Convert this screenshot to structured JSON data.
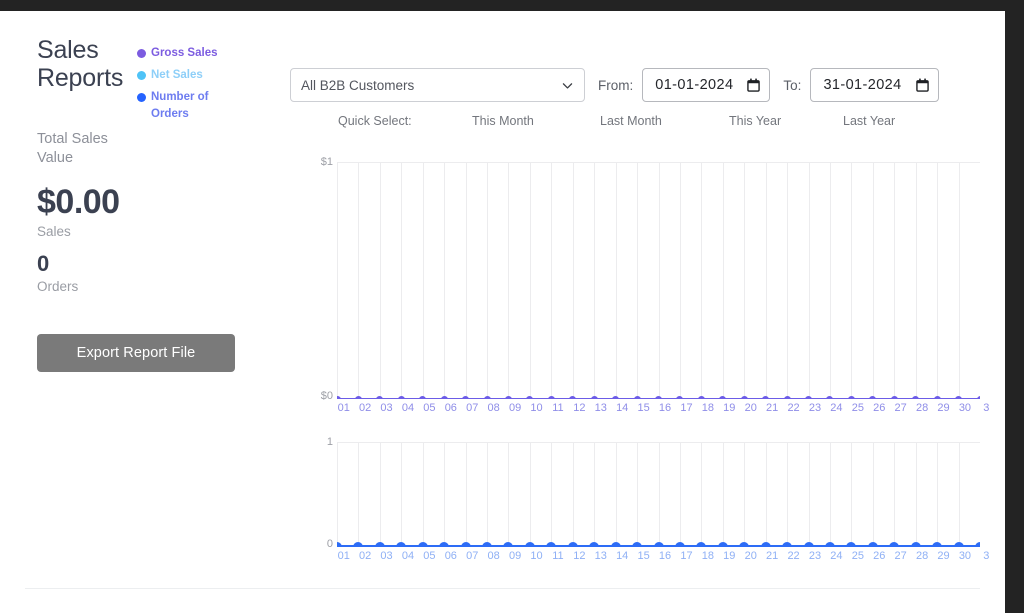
{
  "window": {
    "chrome_color": "#232323",
    "page_background": "#ffffff"
  },
  "summary": {
    "title": "Sales Reports",
    "subtitle": "Total Sales Value",
    "sales_value": "$0.00",
    "sales_caption": "Sales",
    "orders_value": "0",
    "orders_caption": "Orders",
    "export_button": "Export Report File",
    "export_button_color": "#7a7a7a"
  },
  "legend": [
    {
      "label": "Gross Sales",
      "color": "#7c5ce0"
    },
    {
      "label": "Net Sales",
      "color": "#4fc3f7"
    },
    {
      "label": "Number of Orders",
      "color": "#2563ff"
    }
  ],
  "controls": {
    "customer_select": {
      "value": "All B2B Customers",
      "icon": "chevron-down-icon"
    },
    "from": {
      "label": "From:",
      "value": "01-01-2024",
      "icon": "calendar-icon"
    },
    "to": {
      "label": "To:",
      "value": "31-01-2024",
      "icon": "calendar-icon"
    },
    "quick_select": {
      "label": "Quick Select:",
      "options": [
        "This Month",
        "Last Month",
        "This Year",
        "Last Year"
      ]
    }
  },
  "chart_data": [
    {
      "type": "line",
      "title": "",
      "xlabel": "",
      "ylabel": "",
      "ylim": [
        0,
        1
      ],
      "ytick_labels": [
        "$1",
        "$0"
      ],
      "grid": true,
      "legend_position": "external-left",
      "categories": [
        "01",
        "02",
        "03",
        "04",
        "05",
        "06",
        "07",
        "08",
        "09",
        "10",
        "11",
        "12",
        "13",
        "14",
        "15",
        "16",
        "17",
        "18",
        "19",
        "20",
        "21",
        "22",
        "23",
        "24",
        "25",
        "26",
        "27",
        "28",
        "29",
        "30",
        "3"
      ],
      "series": [
        {
          "name": "Gross Sales",
          "color": "#6c5ce7",
          "values": [
            0,
            0,
            0,
            0,
            0,
            0,
            0,
            0,
            0,
            0,
            0,
            0,
            0,
            0,
            0,
            0,
            0,
            0,
            0,
            0,
            0,
            0,
            0,
            0,
            0,
            0,
            0,
            0,
            0,
            0,
            0
          ]
        }
      ]
    },
    {
      "type": "line",
      "title": "",
      "xlabel": "",
      "ylabel": "",
      "ylim": [
        0,
        1
      ],
      "ytick_labels": [
        "1",
        "0"
      ],
      "grid": true,
      "legend_position": "external-left",
      "categories": [
        "01",
        "02",
        "03",
        "04",
        "05",
        "06",
        "07",
        "08",
        "09",
        "10",
        "11",
        "12",
        "13",
        "14",
        "15",
        "16",
        "17",
        "18",
        "19",
        "20",
        "21",
        "22",
        "23",
        "24",
        "25",
        "26",
        "27",
        "28",
        "29",
        "30",
        "3"
      ],
      "series": [
        {
          "name": "Number of Orders",
          "color": "#2d6cf6",
          "values": [
            0,
            0,
            0,
            0,
            0,
            0,
            0,
            0,
            0,
            0,
            0,
            0,
            0,
            0,
            0,
            0,
            0,
            0,
            0,
            0,
            0,
            0,
            0,
            0,
            0,
            0,
            0,
            0,
            0,
            0,
            0
          ]
        }
      ]
    }
  ]
}
